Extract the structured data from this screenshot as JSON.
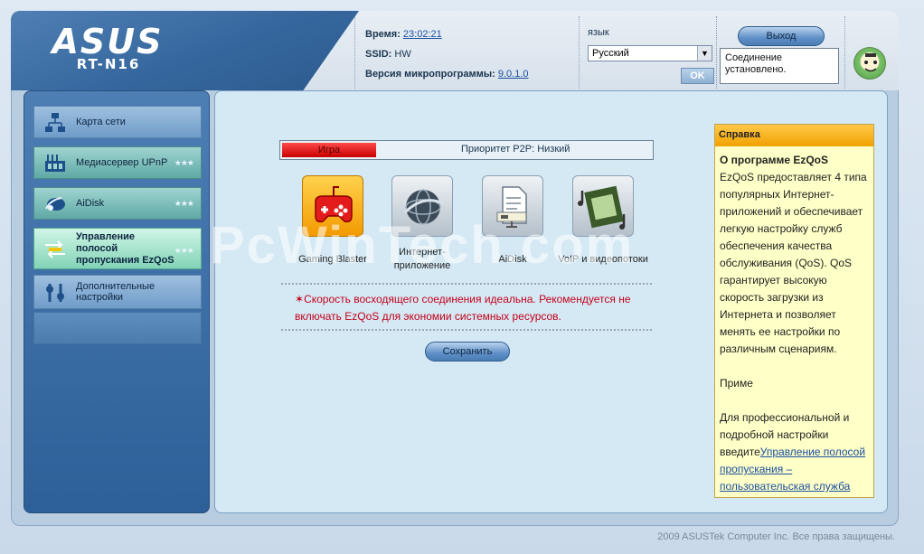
{
  "header": {
    "brand": "ASUS",
    "model": "RT-N16",
    "time_label": "Время:",
    "time_value": "23:02:21",
    "ssid_label": "SSID:",
    "ssid_value": "HW",
    "firmware_label": "Версия микропрограммы:",
    "firmware_value": "9.0.1.0",
    "language_label": "язык",
    "language_selected": "Русский",
    "ok_label": "OK",
    "exit_label": "Выход",
    "status_tooltip": "Соединение установлено."
  },
  "sidebar": {
    "items": [
      {
        "label": "Карта сети",
        "icon": "network-map-icon"
      },
      {
        "label": "Медиасервер UPnP",
        "icon": "media-server-icon"
      },
      {
        "label": "AiDisk",
        "icon": "aidisk-icon"
      },
      {
        "label": "Управление полосой пропускания EzQoS",
        "icon": "ezqos-icon"
      },
      {
        "label": "Дополнительные настройки",
        "icon": "advanced-settings-icon"
      }
    ]
  },
  "main": {
    "priority_active": "Игра",
    "priority_p2p": "Приоритет P2P: Низкий",
    "apps": [
      {
        "label": "Gaming Blaster",
        "icon": "gamepad-icon"
      },
      {
        "label": "Интернет-приложение",
        "icon": "globe-icon"
      },
      {
        "label": "AiDisk",
        "icon": "document-icon"
      },
      {
        "label": "VoIP и видеопотоки",
        "icon": "film-music-icon"
      }
    ],
    "warning_star": "✶",
    "warning_text": "Скорость восходящего соединения идеальна. Рекомендуется не включать EzQoS для экономии системных ресурсов.",
    "save_label": "Сохранить"
  },
  "help": {
    "title": "Справка",
    "heading": "О программе EzQoS",
    "paragraph1": "EzQoS предоставляет 4 типа популярных Интернет-приложений и обеспечивает легкую настройку служб обеспечения качества обслуживания (QoS). QoS гарантирует высокую скорость загрузки из Интернета и позволяет менять ее настройки по различным сценариям.",
    "paragraph2": "Приме",
    "paragraph3": "Для профессиональной и подробной настройки введите",
    "link": "Управление полосой пропускания – пользовательская служба"
  },
  "watermark": "PcWinTech.com",
  "footer": "2009 ASUSTek Computer Inc. Все права защищены."
}
